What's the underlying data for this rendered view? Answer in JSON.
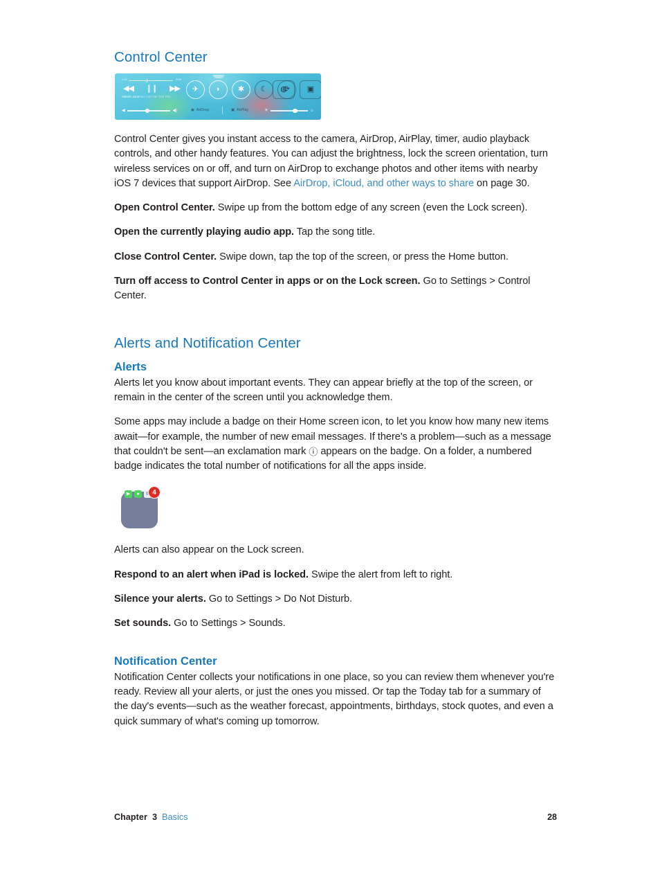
{
  "document": {
    "page_number": "28",
    "footer": {
      "chapter_label": "Chapter",
      "chapter_number": "3",
      "chapter_name": "Basics"
    }
  },
  "sections": {
    "control_center": {
      "heading": "Control Center",
      "figure": {
        "name": "control-center-screenshot",
        "music": {
          "elapsed_time": "1:32",
          "remaining_time": "-2:08",
          "artist": "Valerie June",
          "track": "You Can't Be Told Pus",
          "rewind_icon": "◀◀",
          "pause_icon": "❙❙",
          "forward_icon": "▶▶"
        },
        "toggles": [
          {
            "name": "airplane-mode",
            "glyph": "✈"
          },
          {
            "name": "wifi",
            "glyph": "◗"
          },
          {
            "name": "bluetooth",
            "glyph": "✱"
          },
          {
            "name": "do-not-disturb",
            "glyph": "☾"
          },
          {
            "name": "rotation-lock",
            "glyph": "⟳"
          }
        ],
        "shortcuts": [
          {
            "name": "timer",
            "glyph": "◍"
          },
          {
            "name": "camera",
            "glyph": "▣"
          }
        ],
        "airdrop_label": "AirDrop",
        "airplay_label": "AirPlay",
        "volume_low_icon": "◀",
        "volume_high_icon": "◀)",
        "brightness_low_icon": "☀",
        "brightness_high_icon": "☼"
      },
      "intro_paragraph": {
        "before_link": "Control Center gives you instant access to the camera, AirDrop, AirPlay, timer, audio playback controls, and other handy features. You can adjust the brightness, lock the screen orientation, turn wireless services on or off, and turn on AirDrop to exchange photos and other items with nearby iOS 7 devices that support AirDrop. See ",
        "link_text": "AirDrop, iCloud, and other ways to share",
        "after_link": " on page 30."
      },
      "tasks": [
        {
          "label": "Open Control Center.",
          "text": " Swipe up from the bottom edge of any screen (even the Lock screen)."
        },
        {
          "label": "Open the currently playing audio app.",
          "text": " Tap the song title."
        },
        {
          "label": "Close Control Center.",
          "text": " Swipe down, tap the top of the screen, or press the Home button."
        },
        {
          "label": "Turn off access to Control Center in apps or on the Lock screen.",
          "text": " Go to Settings > Control Center."
        }
      ]
    },
    "alerts_and_notification_center": {
      "heading": "Alerts and Notification Center",
      "alerts": {
        "heading": "Alerts",
        "paragraph_1": "Alerts let you know about important events. They can appear briefly at the top of the screen, or remain in the center of the screen until you acknowledge them.",
        "paragraph_2_before_glyph": "Some apps may include a badge on their Home screen icon, to let you know how many new items await—for example, the number of new email messages. If there's a problem—such as a message that couldn't be sent—an exclamation mark ",
        "paragraph_2_glyph": "⚠",
        "paragraph_2_after_glyph": " appears on the badge. On a folder, a numbered badge indicates the total number of notifications for all the apps inside.",
        "figure": {
          "name": "folder-badge-screenshot",
          "badge_count": "4",
          "mini_icons": [
            {
              "name": "facetime-icon",
              "glyph": "▶"
            },
            {
              "name": "messages-icon",
              "glyph": "●"
            },
            {
              "name": "newsstand-icon",
              "glyph": "▤"
            }
          ]
        },
        "paragraph_3": "Alerts can also appear on the Lock screen.",
        "tasks": [
          {
            "label": "Respond to an alert when iPad is locked.",
            "text": " Swipe the alert from left to right."
          },
          {
            "label": "Silence your alerts.",
            "text": " Go to Settings > Do Not Disturb."
          },
          {
            "label": "Set sounds.",
            "text": " Go to Settings > Sounds."
          }
        ]
      },
      "notification_center": {
        "heading": "Notification Center",
        "paragraph": "Notification Center collects your notifications in one place, so you can review them whenever you're ready. Review all your alerts, or just the ones you missed. Or tap the Today tab for a summary of the day's events—such as the weather forecast, appointments, birthdays, stock quotes, and even a quick summary of what's coming up tomorrow."
      }
    }
  },
  "colors": {
    "heading_blue": "#1878bd",
    "link_blue": "#3a8dd0",
    "body_text": "#231f20",
    "badge_red": "#e02b25",
    "folder_tile": "#767e9e"
  }
}
